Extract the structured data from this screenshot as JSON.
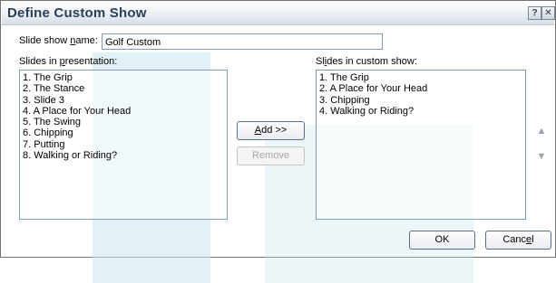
{
  "dialog": {
    "title": "Define Custom Show",
    "help_icon": "question-mark-icon",
    "close_icon": "close-icon"
  },
  "name_label_pre": "Slide show ",
  "name_label_u": "n",
  "name_label_post": "ame:",
  "name_value": "Golf Custom",
  "left": {
    "label_pre": "Slides in ",
    "label_u": "p",
    "label_post": "resentation:",
    "items": [
      "1. The Grip",
      "2. The Stance",
      "3. Slide 3",
      "4. A Place for Your Head",
      "5. The Swing",
      "6. Chipping",
      "7. Putting",
      "8. Walking or Riding?"
    ]
  },
  "right": {
    "label_pre": "Sl",
    "label_u": "i",
    "label_post": "des in custom show:",
    "items": [
      "1. The Grip",
      "2. A Place for Your Head",
      "3. Chipping",
      "4. Walking or Riding?"
    ]
  },
  "buttons": {
    "add_u": "A",
    "add_rest": "dd >>",
    "remove": "Remove",
    "ok": "OK",
    "cancel_pre": "Canc",
    "cancel_u": "e",
    "cancel_post": "l",
    "move_up_icon": "arrow-up-icon",
    "move_down_icon": "arrow-down-icon"
  },
  "colors": {
    "title_text": "#2a3e5a",
    "field_border": "#7f9db9",
    "background_accent": "#c9e6ec"
  }
}
